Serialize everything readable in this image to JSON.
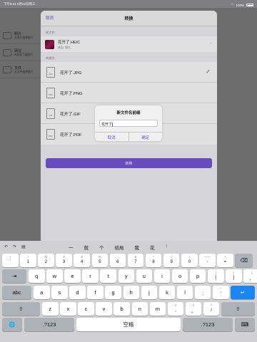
{
  "status": {
    "time": "下午6:41",
    "date": "6月22日周三",
    "battery": "100%"
  },
  "background": {
    "items": [
      {
        "title": "照片",
        "sub": "从照片选择图片"
      },
      {
        "title": "网址",
        "sub": "从网址下载图片"
      },
      {
        "title": "文件",
        "sub": "从文件选择图片"
      }
    ]
  },
  "modal": {
    "cancel": "取消",
    "title": "转换",
    "source_label": "原文件",
    "source_name": "花开了.HEIC",
    "source_sub": "来自: 照片",
    "convert_to_label": "转换为",
    "formats": [
      {
        "icon": "JPG",
        "name": "花开了.JPG",
        "selected": true
      },
      {
        "icon": "PNG",
        "name": "花开了.PNG",
        "selected": false
      },
      {
        "icon": "GIF",
        "name": "花开了.GIF",
        "selected": false
      },
      {
        "icon": "PDF",
        "name": "花开了.PDF",
        "selected": false
      }
    ],
    "convert_button": "转换"
  },
  "alert": {
    "title": "新文件名前缀",
    "value": "花开了",
    "cancel": "取消",
    "ok": "确定"
  },
  "keyboard": {
    "candidates": [
      "一",
      "就",
      "个",
      "结局",
      "我",
      "花",
      "↑"
    ],
    "row1": [
      {
        "s": "~",
        "l": "`"
      },
      {
        "s": "!",
        "l": "1"
      },
      {
        "s": "@",
        "l": "2"
      },
      {
        "s": "#",
        "l": "3"
      },
      {
        "s": "¥",
        "l": "4"
      },
      {
        "s": "%",
        "l": "5"
      },
      {
        "s": "……",
        "l": "6"
      },
      {
        "s": "&",
        "l": "7"
      },
      {
        "s": "*",
        "l": "8"
      },
      {
        "s": "(",
        "l": "9"
      },
      {
        "s": ")",
        "l": "0"
      },
      {
        "s": "——",
        "l": "-"
      },
      {
        "s": "+",
        "l": "="
      }
    ],
    "delete": "⌫",
    "tab": "⇥",
    "row2": [
      "q",
      "w",
      "e",
      "r",
      "t",
      "y",
      "u",
      "i",
      "o",
      "p"
    ],
    "row2_extra": [
      {
        "s": "{",
        "l": "["
      },
      {
        "s": "}",
        "l": "]"
      },
      {
        "s": "|",
        "l": "、"
      }
    ],
    "abc": "abc",
    "row3": [
      "a",
      "s",
      "d",
      "f",
      "g",
      "h",
      "j",
      "k",
      "l"
    ],
    "row3_extra": [
      {
        "s": ":",
        "l": ";"
      },
      {
        "s": "\"",
        "l": "'"
      }
    ],
    "return": "↵",
    "shift": "⇧",
    "row4": [
      "z",
      "x",
      "c",
      "v",
      "b",
      "n",
      "m"
    ],
    "row4_extra": [
      {
        "s": "<",
        "l": ","
      },
      {
        "s": ">",
        "l": "。"
      },
      {
        "s": "?",
        "l": "/"
      }
    ],
    "globe": "🌐",
    "num_left": ".?123",
    "space": "空格",
    "num_right": ".?123",
    "hide": "⌨"
  }
}
